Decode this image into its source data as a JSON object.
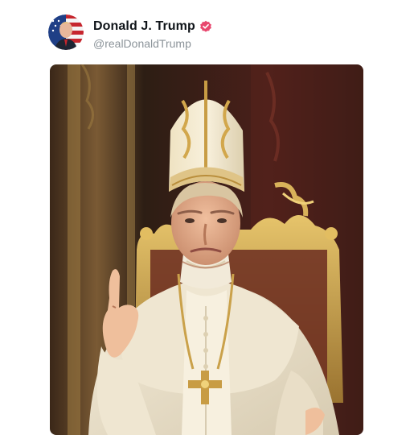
{
  "post": {
    "display_name": "Donald J. Trump",
    "handle": "@realDonaldTrump",
    "verified": true,
    "avatar_icon": "avatar-flag-portrait-icon",
    "verified_icon": "verified-badge-icon",
    "badge_color": "#e8466d"
  },
  "media": {
    "type": "image"
  }
}
